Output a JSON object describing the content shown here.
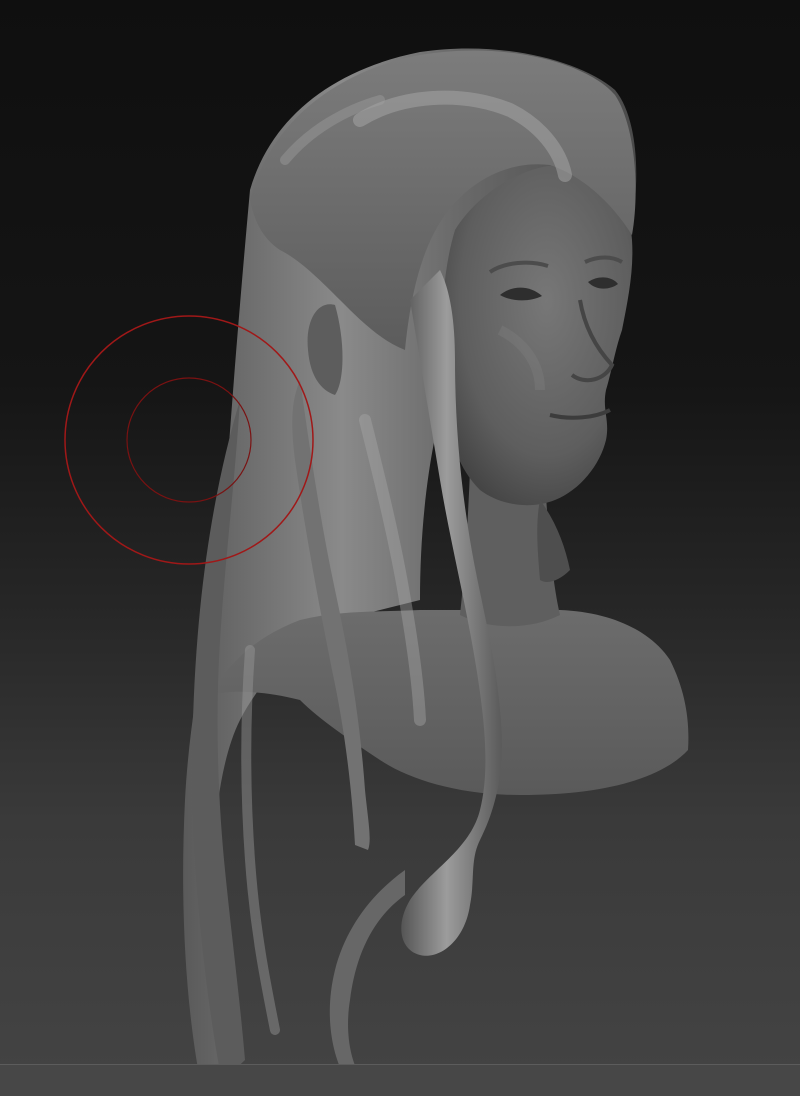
{
  "canvas": {
    "background_top": "#0f0f0f",
    "background_bottom": "#444444",
    "floor_color": "#474747"
  },
  "model": {
    "material_color": "#6e6e6e",
    "highlight_color": "#a8a8a8",
    "shadow_color": "#3a3a3a"
  },
  "brush_cursor": {
    "color": "#a01818"
  }
}
